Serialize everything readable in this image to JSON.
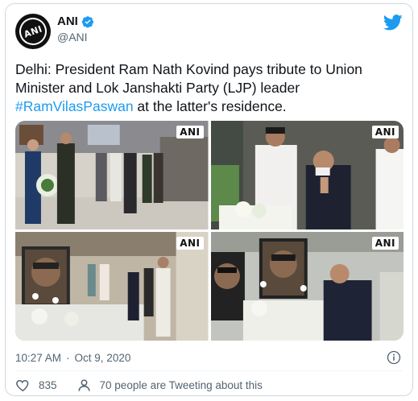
{
  "author": {
    "name": "ANI",
    "handle": "@ANI",
    "avatar_text": "ANI"
  },
  "tweet": {
    "text_before": "Delhi: President Ram Nath Kovind pays tribute to Union Minister and Lok Janshakti Party (LJP) leader ",
    "hashtag": "#RamVilasPaswan",
    "text_after": " at the latter's residence."
  },
  "media": {
    "watermark": "ANI",
    "photos": [
      {
        "id": "photo-1",
        "watermark": "ANI"
      },
      {
        "id": "photo-2",
        "watermark": "ANI"
      },
      {
        "id": "photo-3",
        "watermark": "ANI"
      },
      {
        "id": "photo-4",
        "watermark": "ANI"
      }
    ]
  },
  "meta": {
    "time": "10:27 AM",
    "separator": "·",
    "date": "Oct 9, 2020"
  },
  "actions": {
    "likes": "835",
    "tweeting_text": "70 people are Tweeting about this"
  },
  "colors": {
    "twitter_blue": "#1d9bf0",
    "text_primary": "#0f1419",
    "text_secondary": "#536471"
  }
}
